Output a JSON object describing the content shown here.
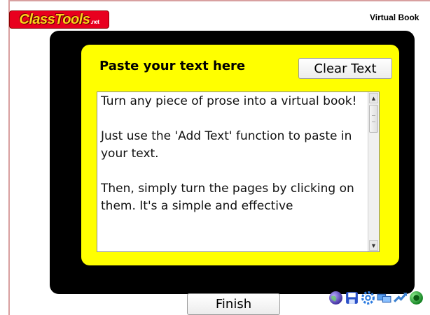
{
  "header": {
    "logo_text": "ClassTools",
    "logo_suffix": ".net",
    "app_title": "Virtual Book"
  },
  "panel": {
    "title": "Paste your text here",
    "clear_button": "Clear Text"
  },
  "textarea": {
    "paragraphs": [
      "Turn any piece of prose into a virtual book!",
      "Just use the 'Add Text' function to paste in your text.",
      "Then, simply turn the pages by clicking on them. It's a simple and effective"
    ]
  },
  "footer": {
    "finish_button": "Finish",
    "icons": [
      "globe-icon",
      "save-icon",
      "settings-icon",
      "screen-icon",
      "share-icon",
      "help-icon"
    ]
  },
  "colors": {
    "panel_bg": "#ffff00",
    "book_bg": "#000000",
    "logo_bg": "#e8001e"
  }
}
